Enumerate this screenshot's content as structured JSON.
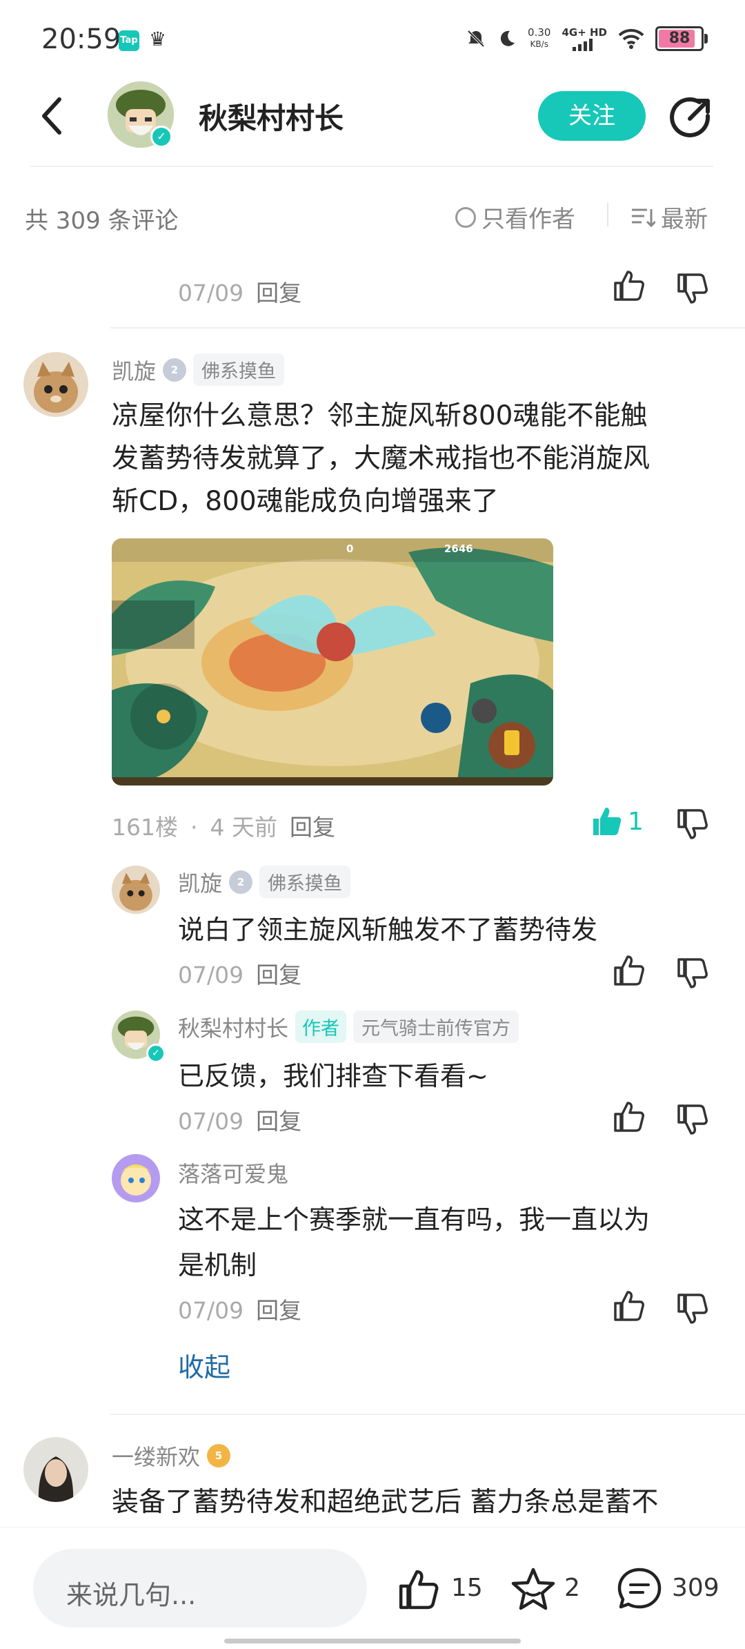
{
  "status_bar": {
    "time": "20:59",
    "tap_badge": "Tap",
    "net_speed": "0.30",
    "net_unit": "KB/s",
    "net_type": "4G+ HD",
    "battery": "88"
  },
  "header": {
    "author_name": "秋梨村村长",
    "follow_label": "关注"
  },
  "comments_bar": {
    "count_label": "共 309 条评论",
    "author_only_label": "只看作者",
    "sort_label": "最新"
  },
  "top_partial": {
    "date": "07/09",
    "reply_label": "回复"
  },
  "main_comment": {
    "username": "凯旋",
    "level": "2",
    "tag": "佛系摸鱼",
    "text_lines": [
      "凉屋你什么意思？邻主旋风斩800魂能不能触",
      "发蓄势待发就算了，大魔术戒指也不能消旋风",
      "斩CD，800魂能成负向增强来了"
    ],
    "hud": {
      "coins": "0",
      "gems": "2646"
    },
    "floor": "161楼",
    "sep": "·",
    "time_ago": "4 天前",
    "reply_label": "回复",
    "like_count": "1"
  },
  "replies": [
    {
      "username": "凯旋",
      "level": "2",
      "tag": "佛系摸鱼",
      "text": [
        "说白了领主旋风斩触发不了蓄势待发"
      ],
      "date": "07/09",
      "reply_label": "回复"
    },
    {
      "username": "秋梨村村长",
      "badge": "作者",
      "tag": "元气骑士前传官方",
      "text": [
        "已反馈，我们排查下看看~"
      ],
      "date": "07/09",
      "reply_label": "回复"
    },
    {
      "username": "落落可爱鬼",
      "text": [
        "这不是上个赛季就一直有吗，我一直以为",
        "是机制"
      ],
      "date": "07/09",
      "reply_label": "回复"
    }
  ],
  "collapse_label": "收起",
  "next_comment": {
    "username": "一缕新欢",
    "level": "5",
    "text": "装备了蓄势待发和超绝武艺后 蓄力条总是蓄不"
  },
  "bottom_bar": {
    "input_placeholder": "来说几句...",
    "like_count": "15",
    "favorite_count": "2",
    "comment_count": "309"
  },
  "colors": {
    "accent": "#17c7b8",
    "link": "#1f6aa6"
  }
}
